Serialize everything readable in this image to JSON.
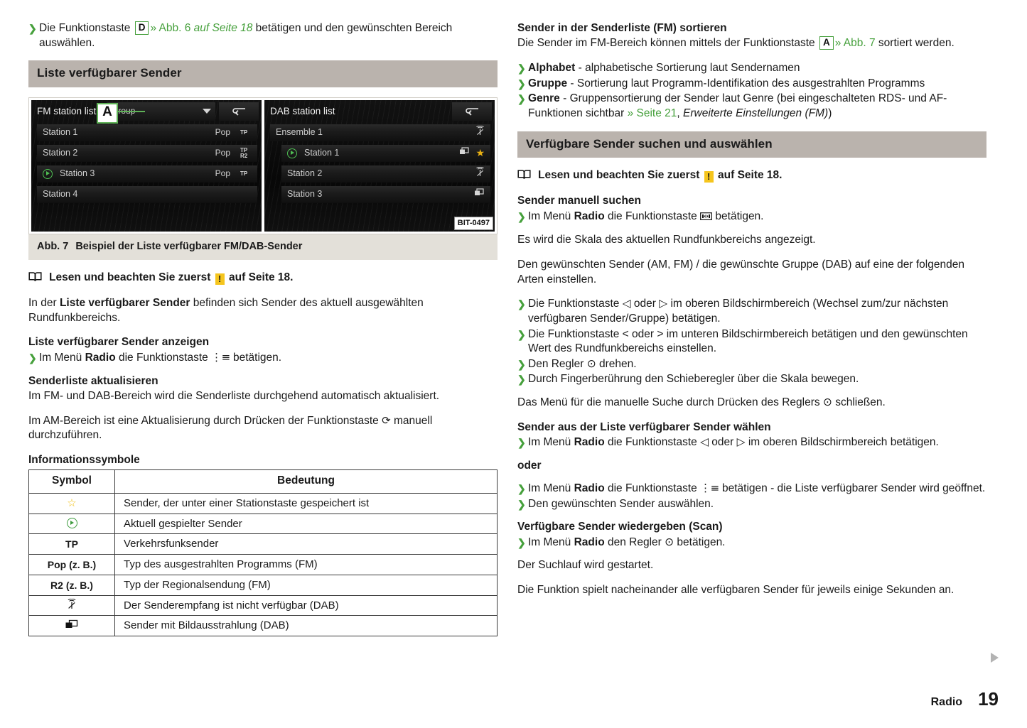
{
  "left": {
    "intro_bullet": {
      "pre": "Die Funktionstaste ",
      "key": "D",
      "link": "» Abb. 6",
      "italic": " auf Seite 18",
      "post": " betätigen und den gewünschten Bereich auswählen."
    },
    "section_title": "Liste verfügbarer Sender",
    "figure": {
      "fm": {
        "title": "FM station list",
        "callout_label": "A",
        "dropdown_value": "Group",
        "back_icon": "back-arrow-icon",
        "rows": [
          {
            "name": "Station 1",
            "pty": "Pop",
            "flags": [
              "TP"
            ],
            "playing": false
          },
          {
            "name": "Station 2",
            "pty": "Pop",
            "flags": [
              "TP",
              "R2"
            ],
            "playing": false
          },
          {
            "name": "Station 3",
            "pty": "Pop",
            "flags": [
              "TP"
            ],
            "playing": true
          },
          {
            "name": "Station 4",
            "pty": "",
            "flags": [],
            "playing": false
          }
        ]
      },
      "dab": {
        "title": "DAB station list",
        "back_icon": "back-arrow-icon",
        "rows": [
          {
            "name": "Ensemble 1",
            "indent": false,
            "playing": false,
            "icons": [
              "no-reception-icon"
            ]
          },
          {
            "name": "Station 1",
            "indent": true,
            "playing": true,
            "icons": [
              "slideshow-icon",
              "star-icon"
            ]
          },
          {
            "name": "Station 2",
            "indent": true,
            "playing": false,
            "icons": [
              "no-reception-icon"
            ]
          },
          {
            "name": "Station 3",
            "indent": true,
            "playing": false,
            "icons": [
              "slideshow-icon"
            ]
          }
        ]
      },
      "bit_label": "BIT-0497"
    },
    "fig_caption": {
      "label": "Abb. 7",
      "text": "Beispiel der Liste verfügbarer FM/DAB-Sender"
    },
    "note": {
      "pre": "Lesen und beachten Sie zuerst ",
      "badge": "!",
      "post": " auf Seite 18."
    },
    "para_liste": {
      "a": "In der ",
      "b": "Liste verfügbarer Sender",
      "c": " befinden sich Sender des aktuell ausgewählten Rundfunkbereichs."
    },
    "heading_anzeigen": "Liste verfügbarer Sender anzeigen",
    "bullet_anzeigen": {
      "a": "Im Menü ",
      "b": "Radio",
      "c": " die Funktionstaste ",
      "glyph": "list-icon",
      "d": " betätigen."
    },
    "heading_aktualisieren": "Senderliste aktualisieren",
    "para_aktualisieren": "Im FM- und DAB-Bereich wird die Senderliste durchgehend automatisch aktualisiert.",
    "para_am": {
      "a": "Im AM-Bereich ist eine Aktualisierung durch Drücken der Funktionstaste ",
      "glyph": "refresh-icon",
      "b": " manuell durchzuführen."
    },
    "heading_symbole": "Informationssymbole",
    "table": {
      "headers": [
        "Symbol",
        "Bedeutung"
      ],
      "rows": [
        {
          "symbol": "star-icon",
          "symbol_text": "",
          "meaning": "Sender, der unter einer Stationstaste gespeichert ist"
        },
        {
          "symbol": "play-circle-icon",
          "symbol_text": "",
          "meaning": "Aktuell gespielter Sender"
        },
        {
          "symbol": "text",
          "symbol_text": "TP",
          "meaning": "Verkehrsfunksender"
        },
        {
          "symbol": "text",
          "symbol_text": "Pop (z. B.)",
          "meaning": "Typ des ausgestrahlten Programms (FM)"
        },
        {
          "symbol": "text",
          "symbol_text": "R2 (z. B.)",
          "meaning": "Typ der Regionalsendung (FM)"
        },
        {
          "symbol": "no-reception-icon",
          "symbol_text": "",
          "meaning": "Der Senderempfang ist nicht verfügbar (DAB)"
        },
        {
          "symbol": "slideshow-icon",
          "symbol_text": "",
          "meaning": "Sender mit Bildausstrahlung (DAB)"
        }
      ]
    }
  },
  "right": {
    "heading_sortieren": "Sender in der Senderliste (FM) sortieren",
    "para_sortieren": {
      "a": "Die Sender im FM-Bereich können mittels der Funktionstaste ",
      "key": "A",
      "link": "» Abb. 7",
      "b": " sortiert werden."
    },
    "sort_options": [
      {
        "bold": "Alphabet",
        "rest": " - alphabetische Sortierung laut Sendernamen"
      },
      {
        "bold": "Gruppe",
        "rest": " - Sortierung laut Programm-Identifikation des ausgestrahlten Programms"
      },
      {
        "bold": "Genre",
        "rest": " - Gruppensortierung der Sender laut Genre (bei eingeschalteten RDS- und AF-Funktionen sichtbar ",
        "link": "» Seite 21",
        "rest2": ", ",
        "italic": "Erweiterte Einstellungen (FM)",
        "rest3": ")"
      }
    ],
    "section_title": "Verfügbare Sender suchen und auswählen",
    "note": {
      "pre": "Lesen und beachten Sie zuerst ",
      "badge": "!",
      "post": " auf Seite 18."
    },
    "heading_manuell": "Sender manuell suchen",
    "bullet_manuell": {
      "a": "Im Menü ",
      "b": "Radio",
      "c": " die Funktionstaste ",
      "glyph": "manual-tune-icon",
      "d": " betätigen."
    },
    "para_skala": "Es wird die Skala des aktuellen Rundfunkbereichs angezeigt.",
    "para_gewuenscht": "Den gewünschten Sender (AM, FM) / die gewünschte Gruppe (DAB) auf eine der folgenden Arten einstellen.",
    "tune_bullets": [
      "Die Funktionstaste ◁ oder ▷ im oberen Bildschirmbereich (Wechsel zum/zur nächsten verfügbaren Sender/Gruppe) betätigen.",
      "Die Funktionstaste < oder > im unteren Bildschirmbereich betätigen und den gewünschten Wert des Rundfunkbereichs einstellen.",
      "Den Regler ⊙ drehen.",
      "Durch Fingerberührung den Schieberegler über die Skala bewegen."
    ],
    "para_schliessen": "Das Menü für die manuelle Suche durch Drücken des Reglers ⊙ schließen.",
    "heading_waehlen": "Sender aus der Liste verfügbarer Sender wählen",
    "bullet_waehlen": {
      "a": "Im Menü ",
      "b": "Radio",
      "c": " die Funktionstaste ◁ oder ▷ im oberen Bildschirmbereich betätigen."
    },
    "oder": "oder",
    "bullets_oder": [
      {
        "a": "Im Menü ",
        "b": "Radio",
        "c": " die Funktionstaste ",
        "glyph": "list-icon",
        "d": " betätigen - die Liste verfügbarer Sender wird geöffnet."
      },
      {
        "plain": "Den gewünschten Sender auswählen."
      }
    ],
    "heading_scan": "Verfügbare Sender wiedergeben (Scan)",
    "bullet_scan": {
      "a": "Im Menü ",
      "b": "Radio",
      "c": " den Regler ⊙ betätigen."
    },
    "para_suchlauf": "Der Suchlauf wird gestartet.",
    "para_funktion": "Die Funktion spielt nacheinander alle verfügbaren Sender für jeweils einige Sekunden an."
  },
  "footer": {
    "chapter": "Radio",
    "page_number": "19"
  },
  "colors": {
    "accent_green": "#46a03c",
    "section_header_bg": "#bab3ad",
    "caption_bg": "#e3e0d9",
    "warning_yellow": "#f5c51d",
    "star_yellow": "#e8b013"
  }
}
